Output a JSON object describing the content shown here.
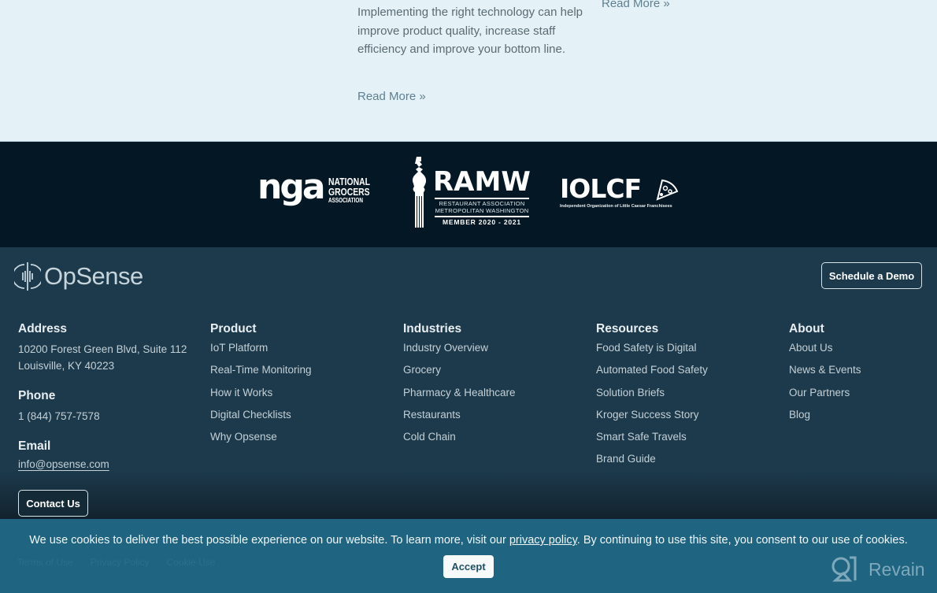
{
  "top_section": {
    "post_excerpt": "Implementing the right technology can help improve product quality, increase staff efficiency and improve your bottom line.",
    "read_more_1": "Read More »",
    "read_more_2": "Read More »"
  },
  "logos": {
    "nga": {
      "mark": "nga",
      "line1": "NATIONAL",
      "line2": "GROCERS",
      "line3": "ASSOCIATION"
    },
    "ramw": {
      "title": "RAMW",
      "line1": "RESTAURANT ASSOCIATION",
      "line2": "METROPOLITAN WASHINGTON",
      "member": "MEMBER 2020 - 2021"
    },
    "iolcf": {
      "title": "IOLCF",
      "subtitle": "Independent Organization of Little Caesar Franchisees"
    }
  },
  "footer": {
    "brand": "OpSense",
    "schedule_demo": "Schedule a Demo",
    "contact_us": "Contact Us",
    "address": {
      "heading": "Address",
      "line1": "10200 Forest Green Blvd, Suite 112",
      "line2": "Louisville, KY 40223"
    },
    "phone": {
      "heading": "Phone",
      "value": "1 (844) 757-7578"
    },
    "email": {
      "heading": "Email",
      "value": "info@opsense.com"
    },
    "columns": [
      {
        "heading": "Product",
        "links": [
          "IoT Platform",
          "Real-Time Monitoring",
          "How it Works",
          "Digital Checklists",
          "Why Opsense"
        ]
      },
      {
        "heading": "Industries",
        "links": [
          "Industry Overview",
          "Grocery",
          "Pharmacy & Healthcare",
          "Restaurants",
          "Cold Chain"
        ]
      },
      {
        "heading": "Resources",
        "links": [
          "Food Safety is Digital",
          "Automated Food Safety",
          "Solution Briefs",
          "Kroger Success Story",
          "Smart Safe Travels",
          "Brand Guide"
        ]
      },
      {
        "heading": "About",
        "links": [
          "About Us",
          "News & Events",
          "Our Partners",
          "Blog"
        ]
      }
    ],
    "legal_links": [
      "Terms of Use",
      "Privacy Policy",
      "Cookie Use"
    ]
  },
  "cookie_banner": {
    "text_before": "We use cookies to deliver the best possible experience on our website. To learn more, visit our ",
    "link": "privacy policy",
    "text_after": ". By continuing to use this site, you consent to our use of cookies.",
    "accept": "Accept"
  },
  "watermark": {
    "label": "Revain"
  },
  "colors": {
    "footer_bg": "#1c3a4c",
    "logo_band_bg": "#031824",
    "cookie_bg": "#1f6581",
    "page_bg": "#e4f2f8"
  }
}
